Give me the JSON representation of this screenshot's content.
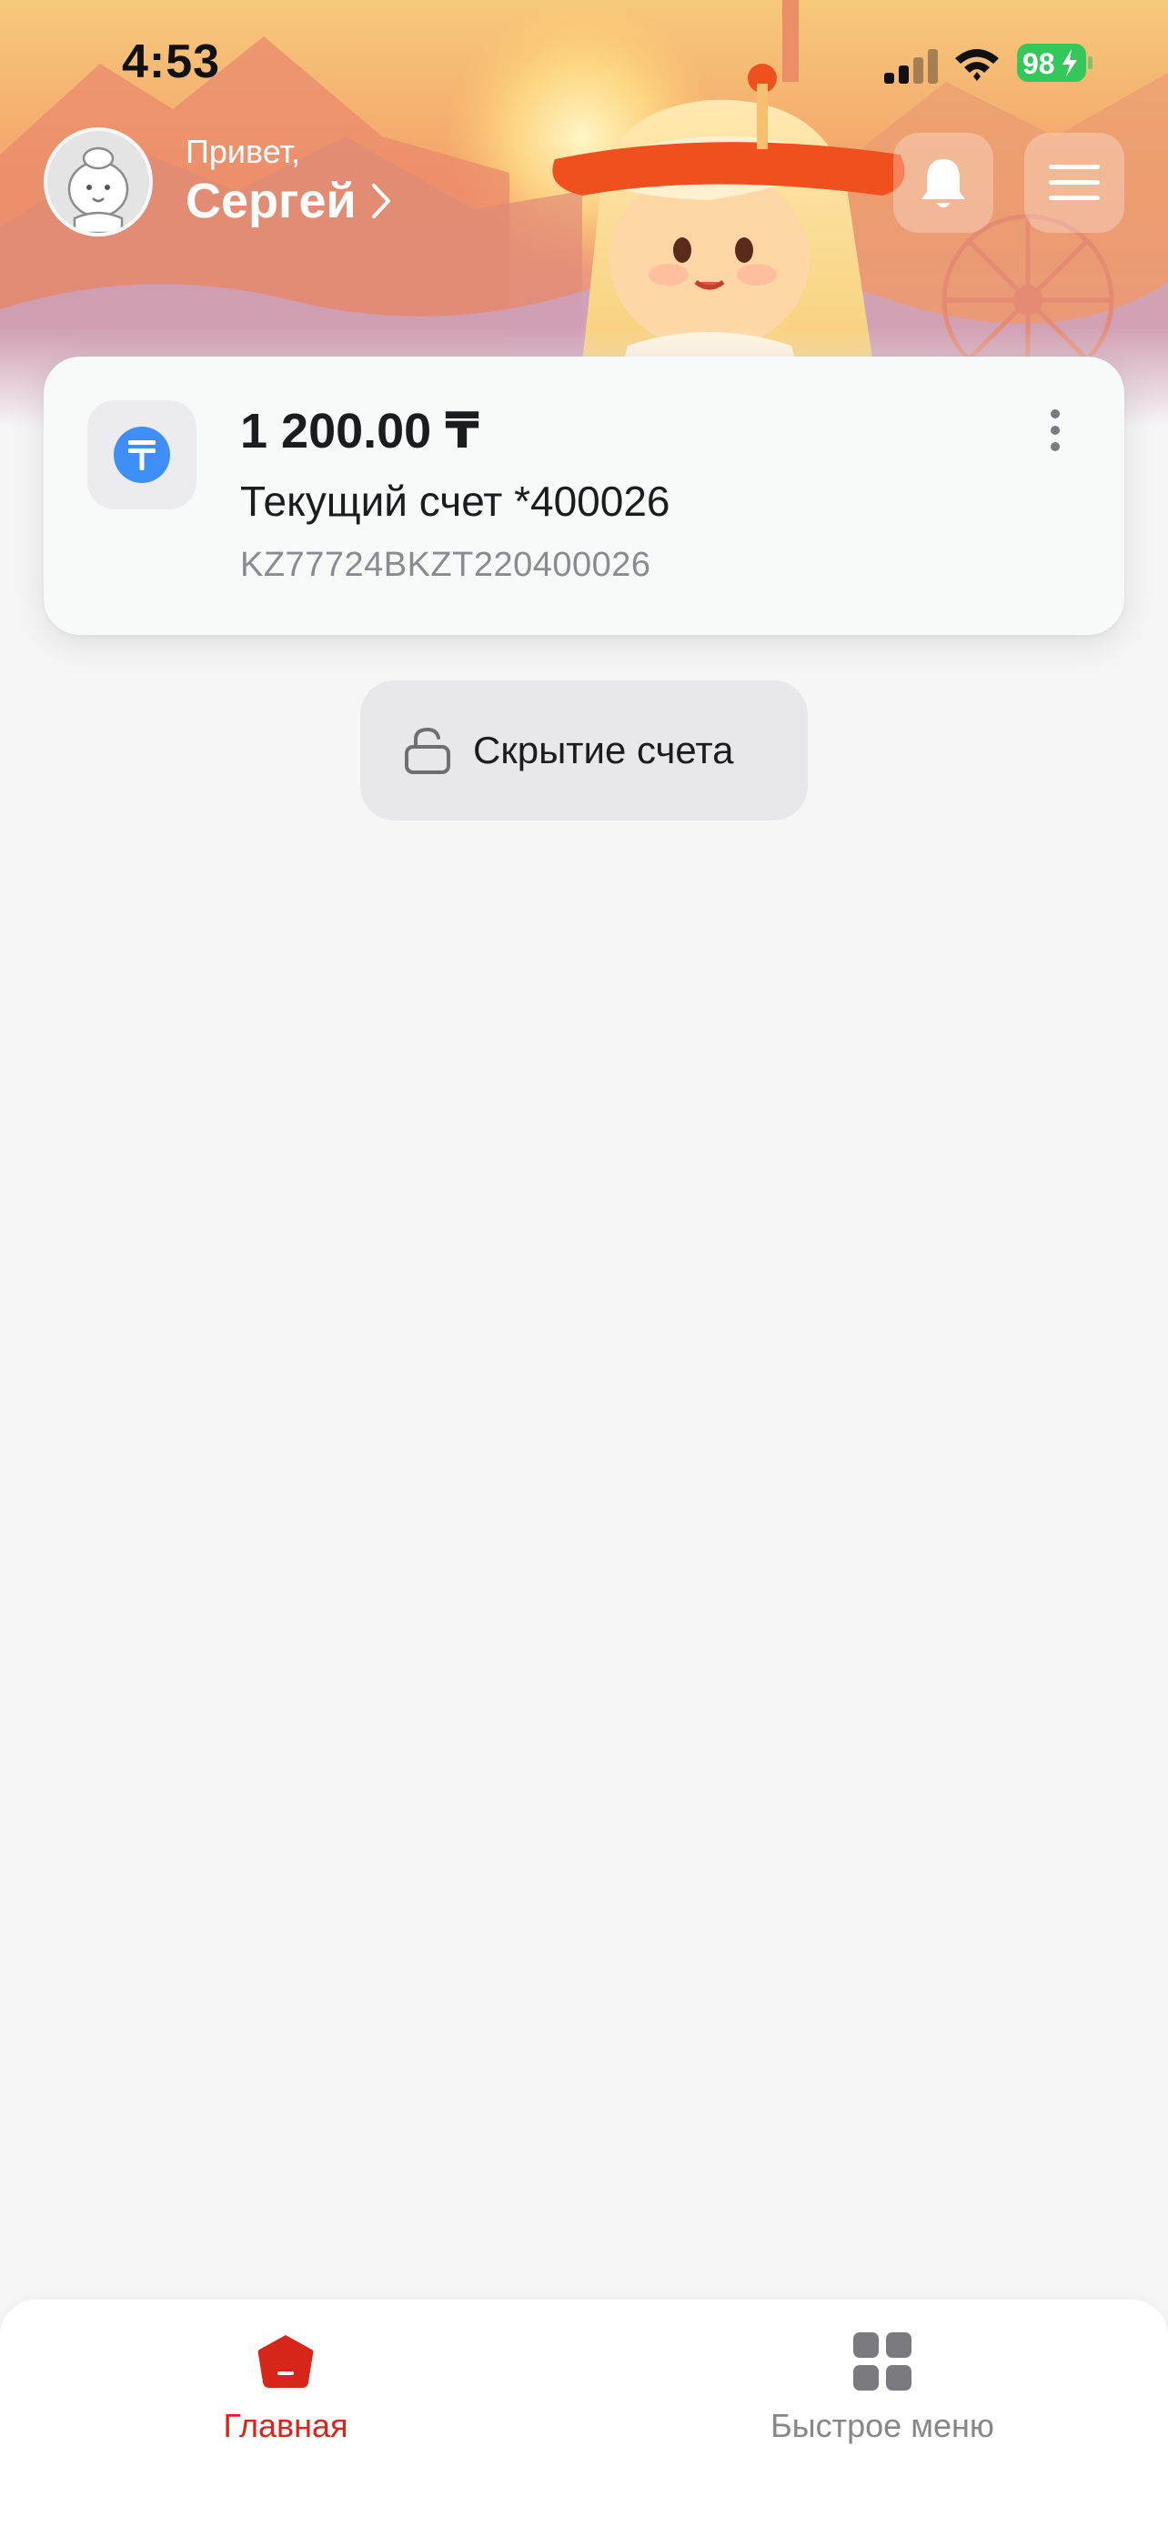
{
  "status_bar": {
    "time": "4:53",
    "battery": "98",
    "icons": [
      "cellular-signal-icon",
      "wifi-icon",
      "battery-charging-icon"
    ]
  },
  "header": {
    "greeting": "Привет,",
    "user_name": "Сергей",
    "icons": [
      "avatar",
      "chevron-right-icon",
      "bell-icon",
      "hamburger-menu-icon"
    ]
  },
  "account": {
    "balance": "1 200.00 ₸",
    "name": "Текущий счет *400026",
    "iban": "KZ77724BKZT220400026",
    "currency_icon": "tenge-icon",
    "menu_icon": "more-vertical-icon"
  },
  "hide_accounts": {
    "label": "Скрытие счета",
    "icon": "unlock-icon"
  },
  "tab_bar": {
    "tabs": [
      {
        "label": "Главная",
        "icon": "home-icon",
        "active": true
      },
      {
        "label": "Быстрое меню",
        "icon": "grid-icon",
        "active": false
      }
    ]
  },
  "colors": {
    "accent": "#d8251a",
    "currency_blue": "#3e8ef7",
    "background": "#f6f6f7"
  }
}
